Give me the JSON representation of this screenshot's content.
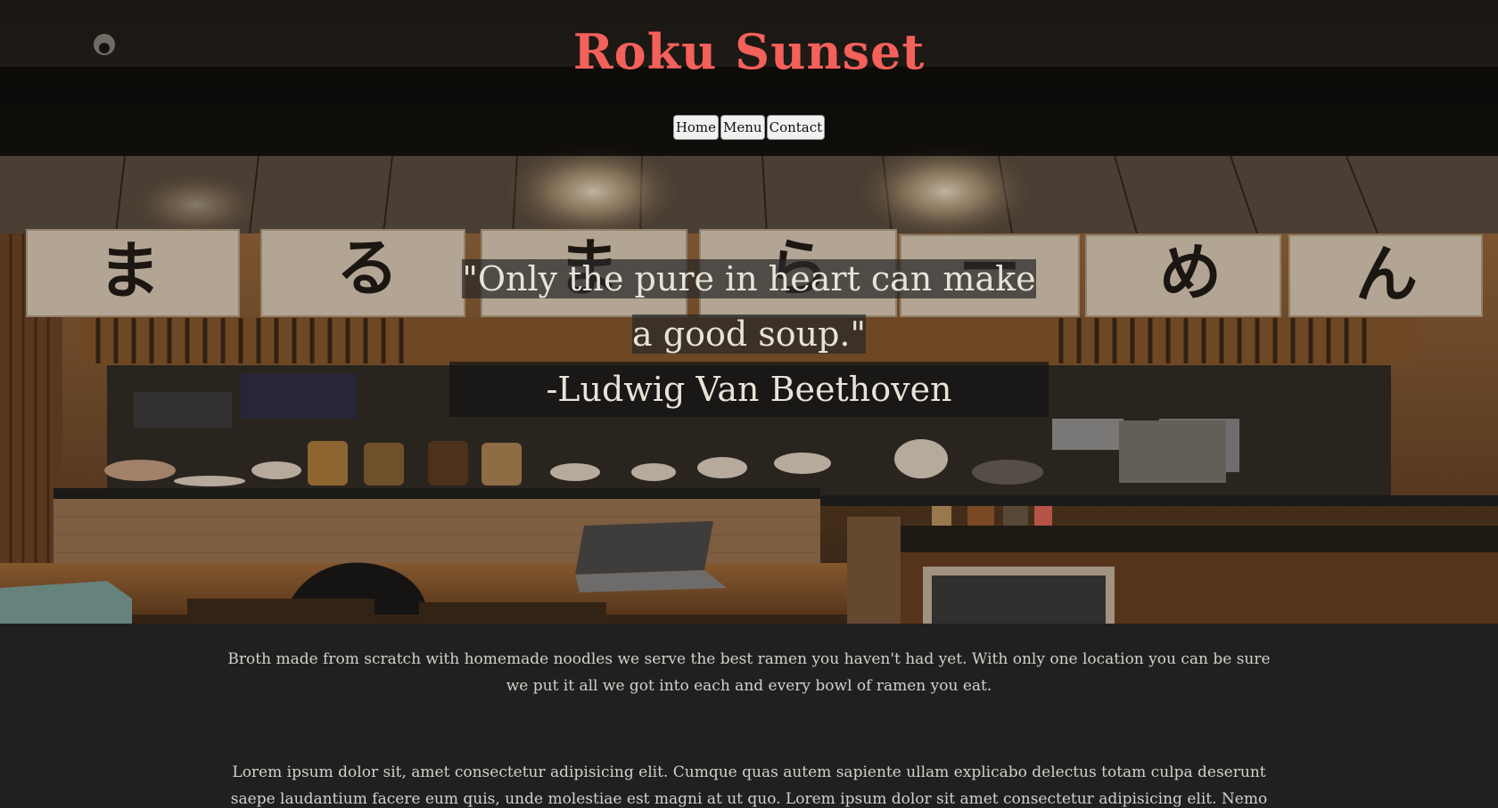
{
  "site": {
    "title": "Roku Sunset",
    "accent_color": "#f4605a"
  },
  "nav": {
    "items": [
      {
        "label": "Home"
      },
      {
        "label": "Menu"
      },
      {
        "label": "Contact"
      }
    ]
  },
  "hero": {
    "banner_characters": [
      "ま",
      "る",
      "ま",
      "ら",
      "ー",
      "め",
      "ん"
    ],
    "quote": "\"Only the pure in heart can make a good soup.\"",
    "author": "-Ludwig Van Beethoven"
  },
  "content": {
    "paragraph_1": "Broth made from scratch with homemade noodles we serve the best ramen you haven't had yet. With only one location you can be sure we put it all we got into each and every bowl of ramen you eat.",
    "paragraph_2": "Lorem ipsum dolor sit, amet consectetur adipisicing elit. Cumque quas autem sapiente ullam explicabo delectus totam culpa deserunt saepe laudantium facere eum quis, unde molestiae est magni at ut quo. Lorem ipsum dolor sit amet consectetur adipisicing elit. Nemo dicta tenetur"
  }
}
